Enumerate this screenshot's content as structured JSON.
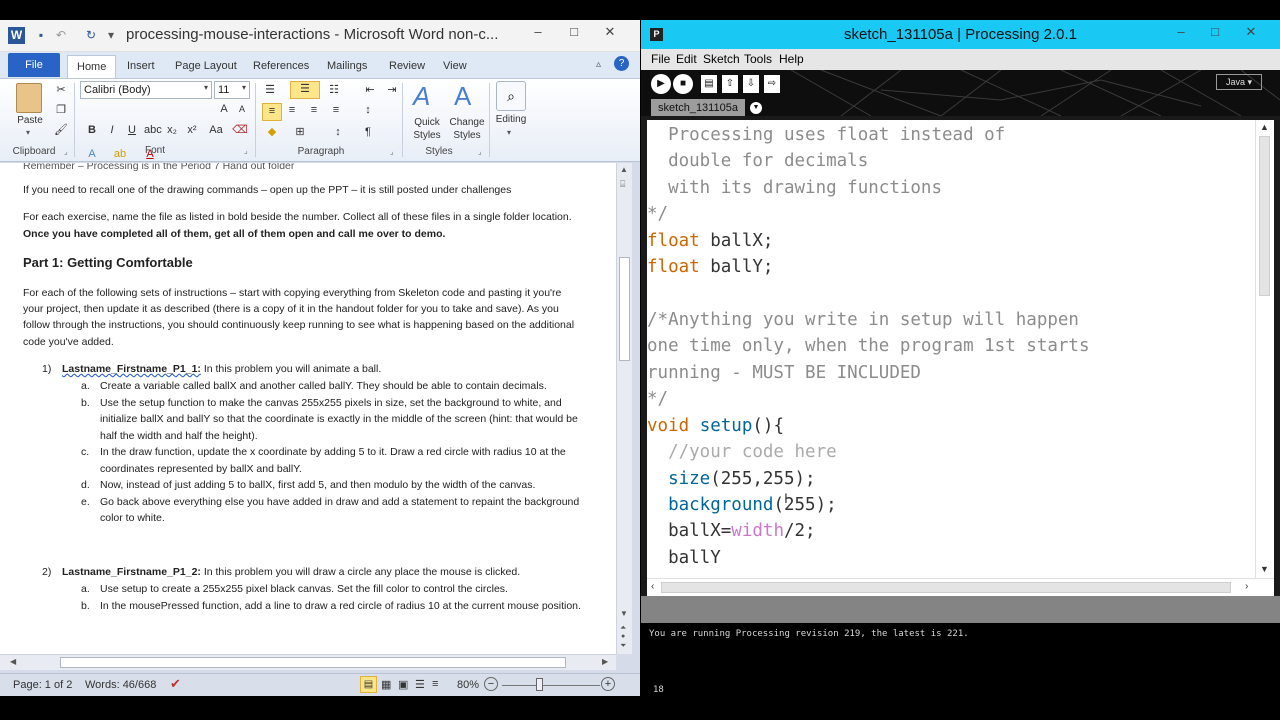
{
  "word": {
    "title": "processing-mouse-interactions - Microsoft Word non-c...",
    "tabs": {
      "file": "File",
      "home": "Home",
      "insert": "Insert",
      "page_layout": "Page Layout",
      "references": "References",
      "mailings": "Mailings",
      "review": "Review",
      "view": "View"
    },
    "ribbon": {
      "font_name": "Calibri (Body)",
      "font_size": "11",
      "paste_label": "Paste",
      "quick_styles_label": "Quick Styles",
      "change_styles_label": "Change Styles",
      "editing_label": "Editing",
      "groups": {
        "clipboard": "Clipboard",
        "font": "Font",
        "paragraph": "Paragraph",
        "styles": "Styles"
      }
    },
    "document": {
      "line0": "Remember – Processing is in the Period 7 Hand out folder",
      "line1": "If you need to recall one of the drawing commands – open up the PPT – it is still posted under challenges",
      "line2": "For each exercise, name the file as listed in bold beside the number.  Collect all of these files in a single folder location.",
      "line3": "Once you have completed all of them, get all of them open and call me over to demo.",
      "heading": "Part 1: Getting Comfortable",
      "para_1": "For each of the following sets of instructions – start with copying everything from Skeleton code and pasting it you're",
      "para_2": "your project, then update it as described (there is a copy of it in the handout folder for you to take and save). As you",
      "para_3": "follow through the instructions, you should continuously keep running to see what is happening based on the additional",
      "para_4": "code you've added.",
      "item1_num": "1)",
      "item1_title": "Lastname_Firstname_P1_1:",
      "item1_text": " In this problem you will animate a ball.",
      "item1": [
        {
          "letter": "a.",
          "lines": [
            "Create a variable called ballX and another called ballY. They should be able to contain decimals."
          ]
        },
        {
          "letter": "b.",
          "lines": [
            "Use the setup function to make the canvas 255x255  pixels in size, set the background to white, and",
            "initialize ballX and ballY so that the coordinate is exactly in the middle of the screen (hint: that would be",
            "half the width and half the height)."
          ]
        },
        {
          "letter": "c.",
          "lines": [
            " In the draw function, update the x coordinate by adding 5 to it. Draw a red circle with radius 10  at the",
            "coordinates represented by ballX and ballY."
          ]
        },
        {
          "letter": "d.",
          "lines": [
            "Now, instead of just adding 5 to ballX, first add 5, and then modulo by the width of the canvas."
          ]
        },
        {
          "letter": "e.",
          "lines": [
            "Go back above everything else you have added in draw and add a statement to repaint the background",
            "color to white."
          ]
        }
      ],
      "item2_num": "2)",
      "item2_title": "Lastname_Firstname_P1_2:",
      "item2_text": " In this problem you will draw a circle  any place the mouse is clicked.",
      "item2": [
        {
          "letter": "a.",
          "lines": [
            "Use setup to create a 255x255  pixel black canvas. Set the fill color to control the circles."
          ]
        },
        {
          "letter": "b.",
          "lines": [
            "In the mousePressed function, add a line to draw a red circle of radius 10 at the current mouse position."
          ]
        }
      ]
    },
    "status": {
      "page": "Page: 1 of 2",
      "words": "Words: 46/668",
      "zoom": "80%"
    }
  },
  "processing": {
    "title": "sketch_131105a | Processing 2.0.1",
    "menu": [
      "File",
      "Edit",
      "Sketch",
      "Tools",
      "Help"
    ],
    "mode": "Java ▾",
    "tab": "sketch_131105a",
    "code": {
      "l1": "  Processing uses float instead of",
      "l2": "  double for decimals",
      "l3": "  with its drawing functions",
      "l4": "*/",
      "l5_kw": "float",
      "l5_id": " ballX;",
      "l6_kw": "float",
      "l6_id": " ballY;",
      "l8": "/*Anything you write in setup will happen",
      "l9": "one time only, when the program 1st starts",
      "l10": "running - MUST BE INCLUDED",
      "l11": "*/",
      "l12_kw": "void",
      "l12_fn": " setup",
      "l12_id": "(){",
      "l13": "  //your code here",
      "l14_fn": "  size",
      "l14_id": "(255,255);",
      "l15_fn": "  background",
      "l15_id": "(255);",
      "l16_id": "  ballX=",
      "l16_lt": "width",
      "l16_id2": "/2;",
      "l17_id": "  ballY"
    },
    "console": "You are running Processing revision 219, the latest is 221.",
    "line_number": "18"
  }
}
